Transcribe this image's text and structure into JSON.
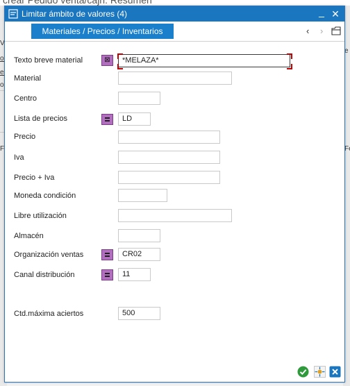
{
  "background": {
    "partial_title": "crear Pedido venta/cajn: Resumen",
    "fragments": [
      "Ve",
      "ol",
      "es",
      "o",
      "Fe",
      "e",
      "Fe"
    ]
  },
  "dialog": {
    "title": "Limitar ámbito de valores (4)",
    "minimize_symbol": "_",
    "close_symbol": "✕",
    "tab_label": "Materiales / Precios / Inventarios",
    "nav_prev": "‹",
    "nav_next": "›"
  },
  "fields": [
    {
      "label": "Texto breve material",
      "value": "*MELAZA*",
      "selection": "exclude"
    },
    {
      "label": "Material",
      "value": ""
    },
    {
      "label": "Centro",
      "value": ""
    },
    {
      "label": "Lista de precios",
      "value": "LD",
      "selection": "equal"
    },
    {
      "label": "Precio",
      "value": ""
    },
    {
      "label": "Iva",
      "value": ""
    },
    {
      "label": "Precio + Iva",
      "value": ""
    },
    {
      "label": "Moneda condición",
      "value": ""
    },
    {
      "label": "Libre utilización",
      "value": ""
    },
    {
      "label": "Almacén",
      "value": ""
    },
    {
      "label": "Organización ventas",
      "value": "CR02",
      "selection": "equal"
    },
    {
      "label": "Canal distribución",
      "value": "11",
      "selection": "equal"
    }
  ],
  "max_hits": {
    "label": "Ctd.máxima aciertos",
    "value": "500"
  },
  "colors": {
    "title_bar": "#1a76bf",
    "tab": "#1a80cc",
    "selection_button": "#b26fbf",
    "confirm": "#2e9a3c",
    "cancel": "#1a76bf"
  }
}
